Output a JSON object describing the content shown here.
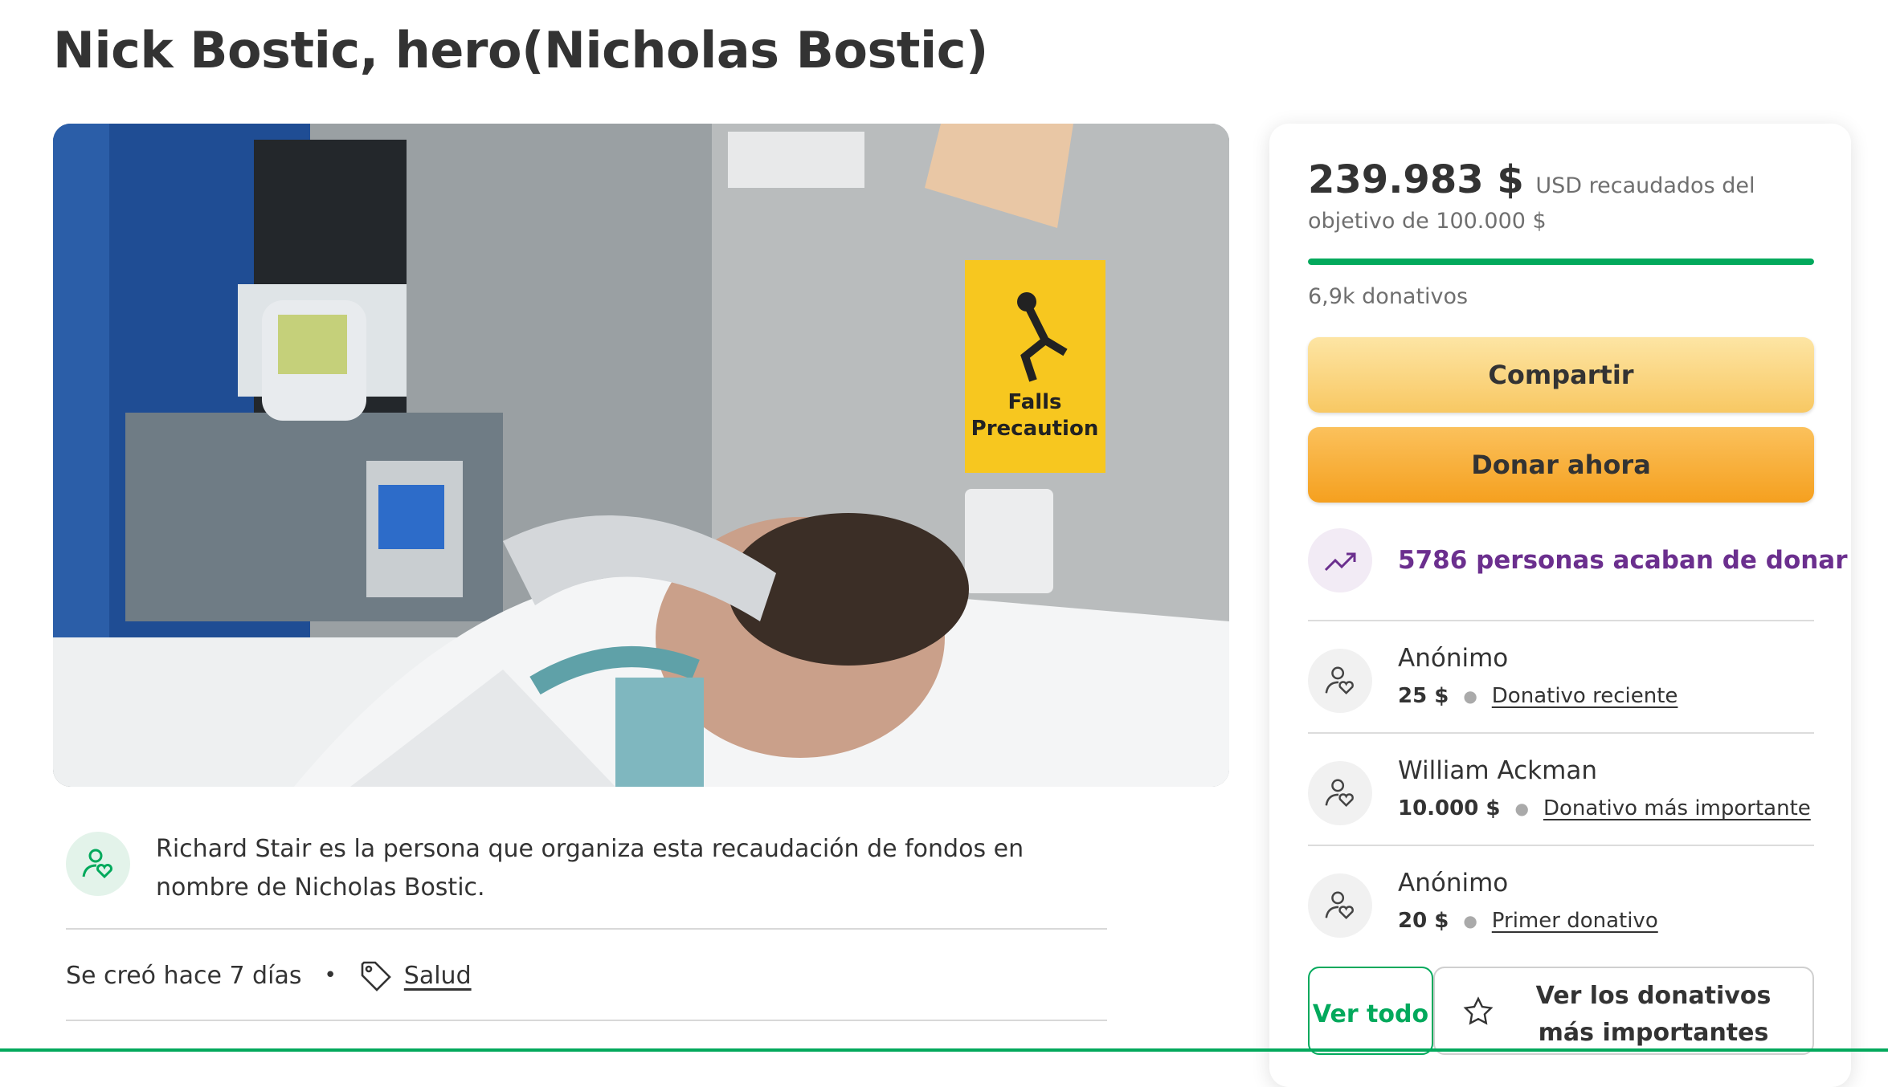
{
  "page": {
    "title": "Nick Bostic, hero(Nicholas Bostic)"
  },
  "hero_image": {
    "sign_line1": "Falls",
    "sign_line2": "Precaution"
  },
  "organizer": {
    "text": "Richard Stair es la persona que organiza esta recaudación de fondos en nombre de Nicholas Bostic."
  },
  "meta": {
    "created": "Se creó hace 7 días",
    "category": "Salud"
  },
  "donation_card": {
    "raised_amount": "239.983 $",
    "raised_suffix": "USD recaudados del objetivo de 100.000 $",
    "progress_percent": 100,
    "donation_count": "6,9k donativos",
    "share_label": "Compartir",
    "donate_label": "Donar ahora",
    "recent_donors_text": "5786 personas acaban de donar",
    "donors": [
      {
        "name": "Anónimo",
        "amount": "25 $",
        "tag": "Donativo reciente"
      },
      {
        "name": "William Ackman",
        "amount": "10.000 $",
        "tag": "Donativo más importante"
      },
      {
        "name": "Anónimo",
        "amount": "20 $",
        "tag": "Primer donativo"
      }
    ],
    "see_all_label": "Ver todo",
    "see_top_label": "Ver los donativos más importantes"
  },
  "colors": {
    "accent_green": "#02a95c",
    "purple": "#6b2f8e",
    "share_yellow": "#f8c863",
    "donate_orange": "#f5a01f"
  }
}
